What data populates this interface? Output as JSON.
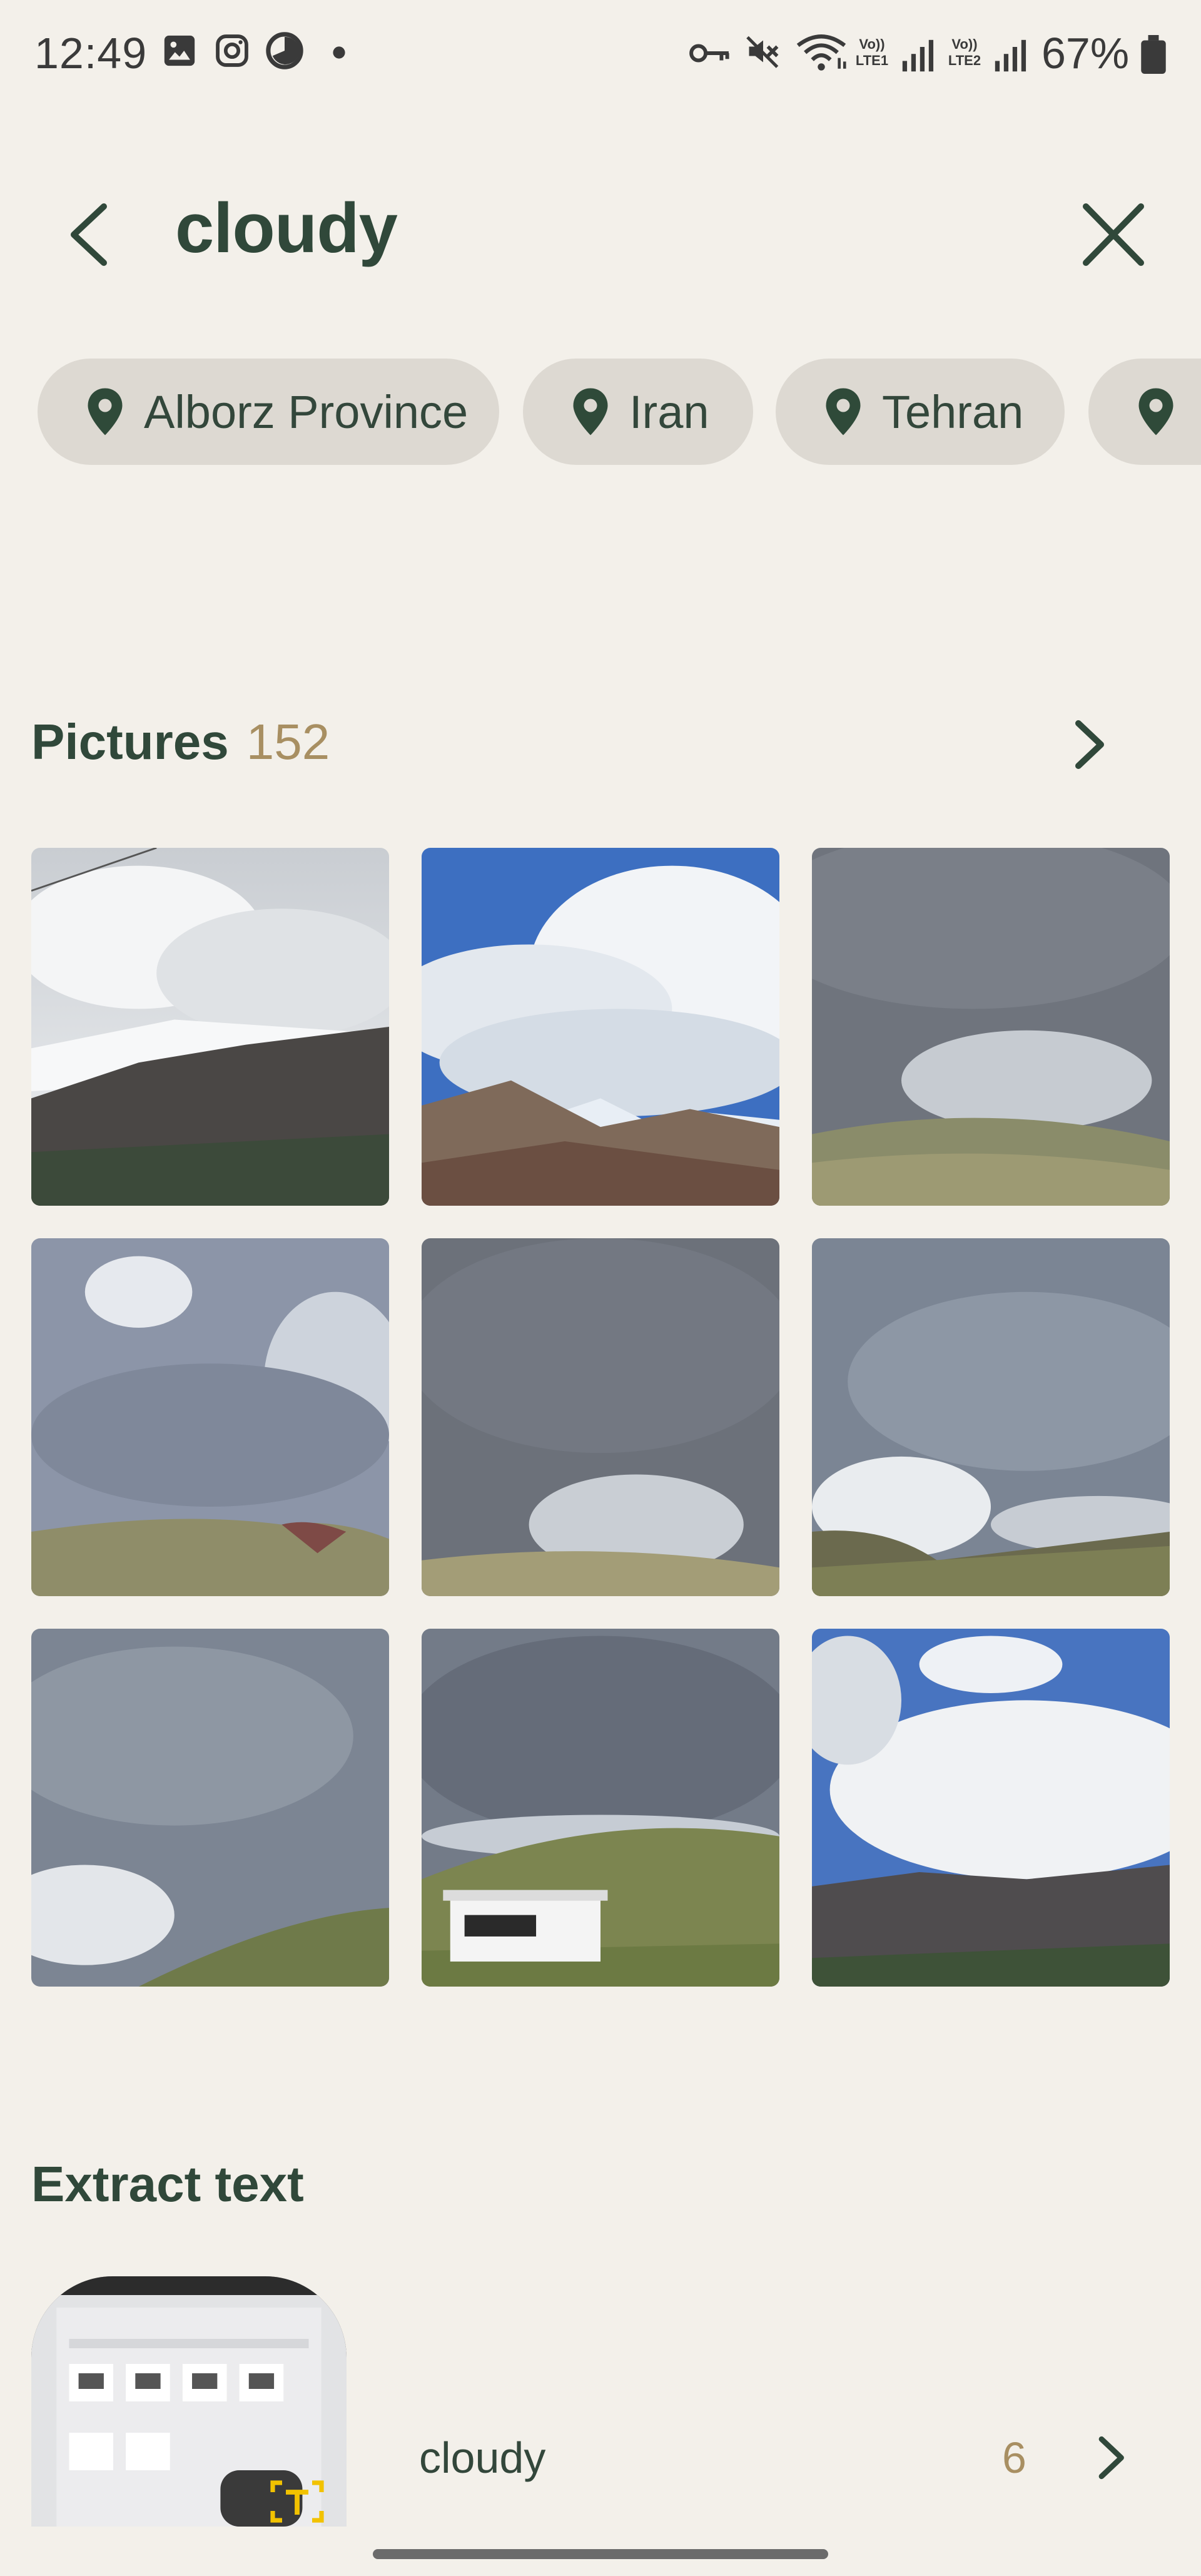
{
  "status_bar": {
    "time": "12:49",
    "battery": "67%",
    "left_icons": [
      "gallery-icon",
      "instagram-icon",
      "timer-icon",
      "dot-icon"
    ],
    "right_icons": [
      "vpn-key-icon",
      "mute-icon",
      "wifi-icon",
      "signal-lte1-icon",
      "signal-lte2-icon",
      "battery-icon"
    ],
    "sim1_label": "Vo)) LTE1",
    "sim2_label": "Vo)) LTE2"
  },
  "search": {
    "query": "cloudy"
  },
  "chips": [
    {
      "label": "Alborz Province",
      "icon": "location-pin-icon"
    },
    {
      "label": "Iran",
      "icon": "location-pin-icon"
    },
    {
      "label": "Tehran",
      "icon": "location-pin-icon"
    },
    {
      "label": "",
      "icon": "location-pin-icon"
    }
  ],
  "pictures": {
    "title": "Pictures",
    "count": "152"
  },
  "extract_text": {
    "title": "Extract text",
    "label": "cloudy",
    "count": "6"
  },
  "colors": {
    "background": "#f3f0ea",
    "primary_text": "#30483a",
    "accent_count": "#a88f62",
    "chip_bg": "#ddd9d2",
    "pin": "#2f4a39"
  }
}
